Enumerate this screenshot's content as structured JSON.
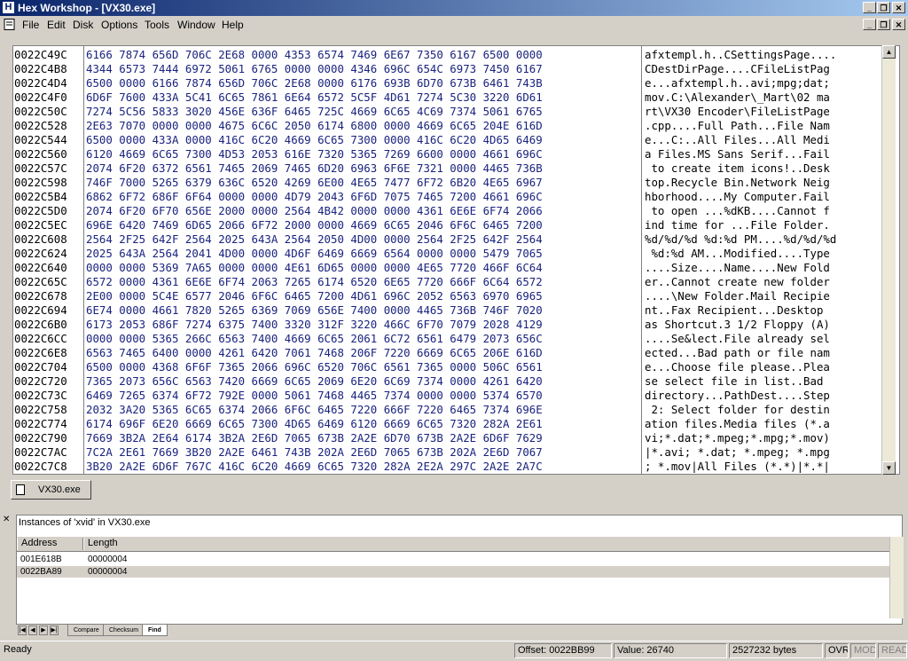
{
  "window": {
    "title": "Hex Workshop - [VX30.exe]",
    "app_icon": "H"
  },
  "menu": [
    "File",
    "Edit",
    "Disk",
    "Options",
    "Tools",
    "Window",
    "Help"
  ],
  "hex_view": {
    "rows": [
      {
        "addr": "0022C49C",
        "hex": "6166 7874 656D 706C 2E68 0000 4353 6574 7469 6E67 7350 6167 6500 0000",
        "ascii": "afxtempl.h..CSettingsPage...."
      },
      {
        "addr": "0022C4B8",
        "hex": "4344 6573 7444 6972 5061 6765 0000 0000 4346 696C 654C 6973 7450 6167",
        "ascii": "CDestDirPage....CFileListPag"
      },
      {
        "addr": "0022C4D4",
        "hex": "6500 0000 6166 7874 656D 706C 2E68 0000 6176 693B 6D70 673B 6461 743B",
        "ascii": "e...afxtempl.h..avi;mpg;dat;"
      },
      {
        "addr": "0022C4F0",
        "hex": "6D6F 7600 433A 5C41 6C65 7861 6E64 6572 5C5F 4D61 7274 5C30 3220 6D61",
        "ascii": "mov.C:\\Alexander\\_Mart\\02 ma"
      },
      {
        "addr": "0022C50C",
        "hex": "7274 5C56 5833 3020 456E 636F 6465 725C 4669 6C65 4C69 7374 5061 6765",
        "ascii": "rt\\VX30 Encoder\\FileListPage"
      },
      {
        "addr": "0022C528",
        "hex": "2E63 7070 0000 0000 4675 6C6C 2050 6174 6800 0000 4669 6C65 204E 616D",
        "ascii": ".cpp....Full Path...File Nam"
      },
      {
        "addr": "0022C544",
        "hex": "6500 0000 433A 0000 416C 6C20 4669 6C65 7300 0000 416C 6C20 4D65 6469",
        "ascii": "e...C:..All Files...All Medi"
      },
      {
        "addr": "0022C560",
        "hex": "6120 4669 6C65 7300 4D53 2053 616E 7320 5365 7269 6600 0000 4661 696C",
        "ascii": "a Files.MS Sans Serif...Fail"
      },
      {
        "addr": "0022C57C",
        "hex": "2074 6F20 6372 6561 7465 2069 7465 6D20 6963 6F6E 7321 0000 4465 736B",
        "ascii": " to create item icons!..Desk"
      },
      {
        "addr": "0022C598",
        "hex": "746F 7000 5265 6379 636C 6520 4269 6E00 4E65 7477 6F72 6B20 4E65 6967",
        "ascii": "top.Recycle Bin.Network Neig"
      },
      {
        "addr": "0022C5B4",
        "hex": "6862 6F72 686F 6F64 0000 0000 4D79 2043 6F6D 7075 7465 7200 4661 696C",
        "ascii": "hborhood....My Computer.Fail"
      },
      {
        "addr": "0022C5D0",
        "hex": "2074 6F20 6F70 656E 2000 0000 2564 4B42 0000 0000 4361 6E6E 6F74 2066",
        "ascii": " to open ...%dKB....Cannot f"
      },
      {
        "addr": "0022C5EC",
        "hex": "696E 6420 7469 6D65 2066 6F72 2000 0000 4669 6C65 2046 6F6C 6465 7200",
        "ascii": "ind time for ...File Folder."
      },
      {
        "addr": "0022C608",
        "hex": "2564 2F25 642F 2564 2025 643A 2564 2050 4D00 0000 2564 2F25 642F 2564",
        "ascii": "%d/%d/%d %d:%d PM....%d/%d/%d"
      },
      {
        "addr": "0022C624",
        "hex": "2025 643A 2564 2041 4D00 0000 4D6F 6469 6669 6564 0000 0000 5479 7065",
        "ascii": " %d:%d AM...Modified....Type"
      },
      {
        "addr": "0022C640",
        "hex": "0000 0000 5369 7A65 0000 0000 4E61 6D65 0000 0000 4E65 7720 466F 6C64",
        "ascii": "....Size....Name....New Fold"
      },
      {
        "addr": "0022C65C",
        "hex": "6572 0000 4361 6E6E 6F74 2063 7265 6174 6520 6E65 7720 666F 6C64 6572",
        "ascii": "er..Cannot create new folder"
      },
      {
        "addr": "0022C678",
        "hex": "2E00 0000 5C4E 6577 2046 6F6C 6465 7200 4D61 696C 2052 6563 6970 6965",
        "ascii": "....\\New Folder.Mail Recipie"
      },
      {
        "addr": "0022C694",
        "hex": "6E74 0000 4661 7820 5265 6369 7069 656E 7400 0000 4465 736B 746F 7020",
        "ascii": "nt..Fax Recipient...Desktop "
      },
      {
        "addr": "0022C6B0",
        "hex": "6173 2053 686F 7274 6375 7400 3320 312F 3220 466C 6F70 7079 2028 4129",
        "ascii": "as Shortcut.3 1/2 Floppy (A)"
      },
      {
        "addr": "0022C6CC",
        "hex": "0000 0000 5365 266C 6563 7400 4669 6C65 2061 6C72 6561 6479 2073 656C",
        "ascii": "....Se&lect.File already sel"
      },
      {
        "addr": "0022C6E8",
        "hex": "6563 7465 6400 0000 4261 6420 7061 7468 206F 7220 6669 6C65 206E 616D",
        "ascii": "ected...Bad path or file nam"
      },
      {
        "addr": "0022C704",
        "hex": "6500 0000 4368 6F6F 7365 2066 696C 6520 706C 6561 7365 0000 506C 6561",
        "ascii": "e...Choose file please..Plea"
      },
      {
        "addr": "0022C720",
        "hex": "7365 2073 656C 6563 7420 6669 6C65 2069 6E20 6C69 7374 0000 4261 6420",
        "ascii": "se select file in list..Bad "
      },
      {
        "addr": "0022C73C",
        "hex": "6469 7265 6374 6F72 792E 0000 5061 7468 4465 7374 0000 0000 5374 6570",
        "ascii": "directory...PathDest....Step"
      },
      {
        "addr": "0022C758",
        "hex": "2032 3A20 5365 6C65 6374 2066 6F6C 6465 7220 666F 7220 6465 7374 696E",
        "ascii": " 2: Select folder for destin"
      },
      {
        "addr": "0022C774",
        "hex": "6174 696F 6E20 6669 6C65 7300 4D65 6469 6120 6669 6C65 7320 282A 2E61",
        "ascii": "ation files.Media files (*.a"
      },
      {
        "addr": "0022C790",
        "hex": "7669 3B2A 2E64 6174 3B2A 2E6D 7065 673B 2A2E 6D70 673B 2A2E 6D6F 7629",
        "ascii": "vi;*.dat;*.mpeg;*.mpg;*.mov)"
      },
      {
        "addr": "0022C7AC",
        "hex": "7C2A 2E61 7669 3B20 2A2E 6461 743B 202A 2E6D 7065 673B 202A 2E6D 7067",
        "ascii": "|*.avi; *.dat; *.mpeg; *.mpg"
      },
      {
        "addr": "0022C7C8",
        "hex": "3B20 2A2E 6D6F 767C 416C 6C20 4669 6C65 7320 282A 2E2A 297C 2A2E 2A7C",
        "ascii": "; *.mov|All Files (*.*)|*.*|"
      }
    ]
  },
  "document_tab": {
    "label": "VX30.exe"
  },
  "results_panel": {
    "title": "Instances of 'xvid' in VX30.exe",
    "columns": [
      "Address",
      "Length"
    ],
    "rows": [
      {
        "address": "001E618B",
        "length": "00000004",
        "selected": false
      },
      {
        "address": "0022BA89",
        "length": "00000004",
        "selected": true
      }
    ],
    "tabs": [
      "Compare",
      "Checksum",
      "Find"
    ],
    "active_tab": "Find"
  },
  "status_bar": {
    "ready": "Ready",
    "offset": "Offset: 0022BB99",
    "value": "Value: 26740",
    "size": "2527232 bytes",
    "ovr": "OVR",
    "mod": "MOD",
    "read": "READ"
  }
}
